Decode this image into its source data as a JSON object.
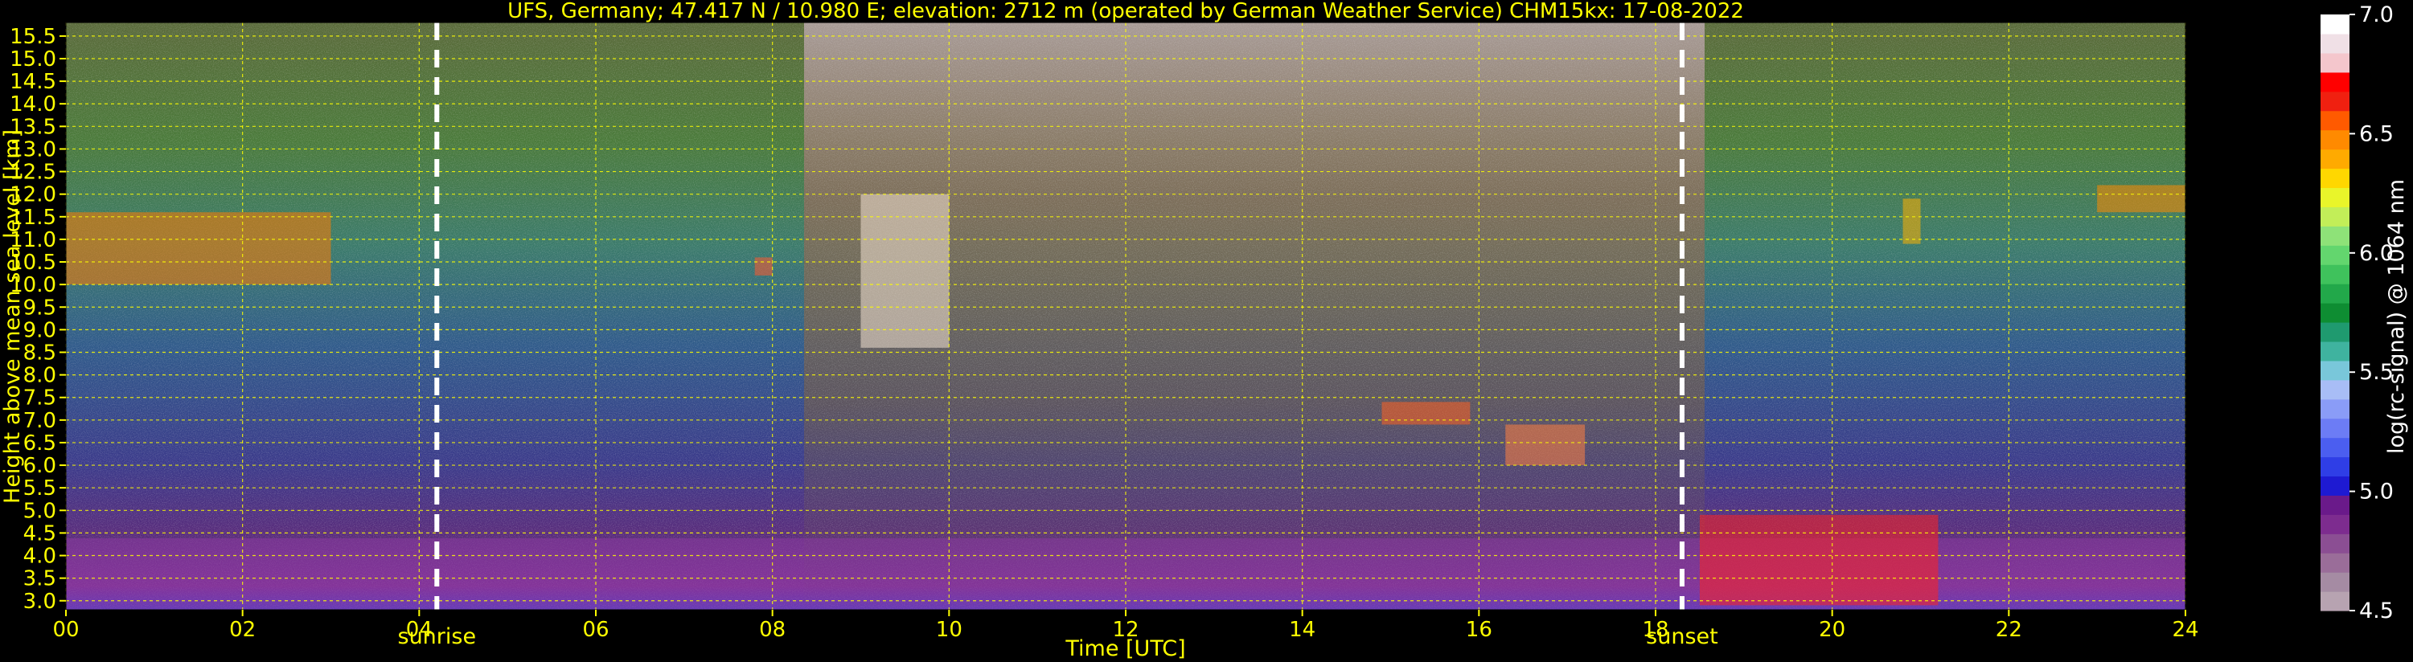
{
  "chart_data": {
    "type": "heatmap",
    "title": "UFS, Germany; 47.417 N / 10.980 E; elevation: 2712 m  (operated by German Weather Service)    CHM15kx: 17-08-2022",
    "xlabel": "Time [UTC]",
    "ylabel": "Height above mean sea level [km]",
    "xlim": [
      0,
      24
    ],
    "ylim": [
      2.8,
      15.8
    ],
    "x_ticks": [
      "00",
      "02",
      "04",
      "06",
      "08",
      "10",
      "12",
      "14",
      "16",
      "18",
      "20",
      "22",
      "24"
    ],
    "y_ticks": [
      "3.0",
      "3.5",
      "4.0",
      "4.5",
      "5.0",
      "5.5",
      "6.0",
      "6.5",
      "7.0",
      "7.5",
      "8.0",
      "8.5",
      "9.0",
      "9.5",
      "10.0",
      "10.5",
      "11.0",
      "11.5",
      "12.0",
      "12.5",
      "13.0",
      "13.5",
      "14.0",
      "14.5",
      "15.0",
      "15.5"
    ],
    "grid": true,
    "markers": [
      {
        "label": "sunrise",
        "x": 4.2
      },
      {
        "label": "sunset",
        "x": 18.3
      }
    ],
    "colorbar": {
      "label": "log(rc-signal) @ 1064 nm",
      "range": [
        4.5,
        7.0
      ],
      "ticks": [
        "4.5",
        "5.0",
        "5.5",
        "6.0",
        "6.5",
        "7.0"
      ],
      "colors": [
        "#b7a3b1",
        "#a58ba3",
        "#9a6d99",
        "#8b4e93",
        "#7d2c8f",
        "#6a1a8a",
        "#1e1ad2",
        "#2f3ee6",
        "#4b5ef0",
        "#6c7cf5",
        "#8a9cf7",
        "#a8bdf6",
        "#79c7da",
        "#3fb39f",
        "#1f9a6f",
        "#0e8d32",
        "#22a84a",
        "#3fc25c",
        "#63d66e",
        "#8ee278",
        "#c2ee58",
        "#e9f52a",
        "#ffd700",
        "#ffaa00",
        "#ff8a00",
        "#ff5a00",
        "#f02010",
        "#ff0000",
        "#f4c6cc",
        "#f0e0e6",
        "#ffffff"
      ]
    },
    "cloud_features": [
      {
        "x0": 0.0,
        "x1": 3.0,
        "y0": 10.0,
        "y1": 11.6
      },
      {
        "x0": 9.0,
        "x1": 10.0,
        "y0": 8.6,
        "y1": 12.0
      },
      {
        "x0": 7.8,
        "x1": 8.0,
        "y0": 10.2,
        "y1": 10.6
      },
      {
        "x0": 14.9,
        "x1": 15.9,
        "y0": 6.9,
        "y1": 7.4
      },
      {
        "x0": 16.3,
        "x1": 17.2,
        "y0": 6.0,
        "y1": 6.9
      },
      {
        "x0": 20.8,
        "x1": 21.0,
        "y0": 10.9,
        "y1": 11.9
      },
      {
        "x0": 23.0,
        "x1": 24.0,
        "y0": 11.6,
        "y1": 12.2
      },
      {
        "x0": 18.5,
        "x1": 21.2,
        "y0": 2.9,
        "y1": 4.9
      }
    ]
  }
}
